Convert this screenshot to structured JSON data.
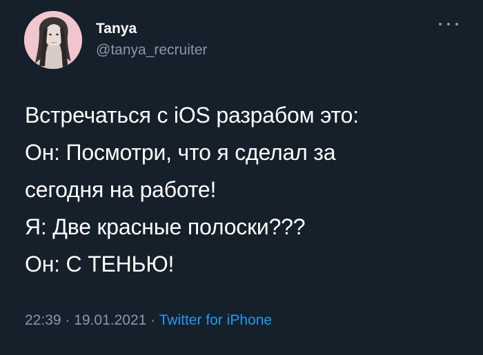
{
  "author": {
    "display_name": "Tanya",
    "handle": "@tanya_recruiter"
  },
  "more_icon": "more-horizontal-icon",
  "tweet_lines": [
    "Встречаться с iOS разрабом это:",
    "Он: Посмотри, что я сделал за",
    "сегодня на работе!",
    "Я: Две красные полоски???",
    "Он: С ТЕНЬЮ!"
  ],
  "meta": {
    "time": "22:39",
    "separator": " · ",
    "date": "19.01.2021",
    "source": "Twitter for iPhone"
  },
  "colors": {
    "background": "#15202b",
    "text": "#ffffff",
    "secondary": "#8b98a5",
    "link": "#1d9bf0"
  }
}
